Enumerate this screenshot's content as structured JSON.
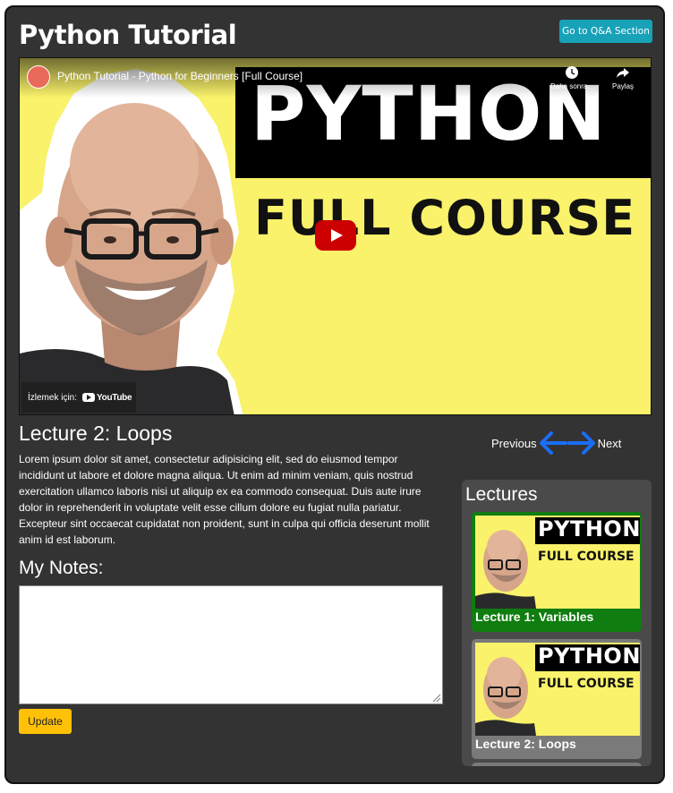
{
  "header": {
    "title": "Python Tutorial",
    "qa_button": "Go to Q&A Section"
  },
  "video": {
    "title": "Python Tutorial - Python for Beginners [Full Course]",
    "thumbnail_line1": "PYTHON",
    "thumbnail_line2": "FULL COURSE",
    "action_watch_later": "Daha sonra...",
    "action_share": "Paylaş",
    "watch_on": "İzlemek için:",
    "youtube_logo": "YouTube",
    "colors": {
      "thumbnail_bg": "#f9f26a",
      "play_button": "#cc0000"
    }
  },
  "lecture": {
    "title": "Lecture 2: Loops",
    "body": "Lorem ipsum dolor sit amet, consectetur adipisicing elit, sed do eiusmod tempor incididunt ut labore et dolore magna aliqua. Ut enim ad minim veniam, quis nostrud exercitation ullamco laboris nisi ut aliquip ex ea commodo consequat. Duis aute irure dolor in reprehenderit in voluptate velit esse cillum dolore eu fugiat nulla pariatur. Excepteur sint occaecat cupidatat non proident, sunt in culpa qui officia deserunt mollit anim id est laborum."
  },
  "notes": {
    "title": "My Notes:",
    "value": "",
    "update_button": "Update"
  },
  "navigation": {
    "previous": "Previous",
    "next": "Next",
    "arrow_color": "#1a6ef5"
  },
  "sidebar": {
    "title": "Lectures",
    "items": [
      {
        "label": "Lecture 1: Variables",
        "thumb_line1": "PYTHON",
        "thumb_line2": "FULL COURSE",
        "color": "#0f7d0f"
      },
      {
        "label": "Lecture 2: Loops",
        "thumb_line1": "PYTHON",
        "thumb_line2": "FULL COURSE",
        "color": "#7a7a7a"
      }
    ]
  },
  "colors": {
    "page_bg": "#333333",
    "qa_button": "#17a2b8",
    "update_button": "#ffc107"
  }
}
